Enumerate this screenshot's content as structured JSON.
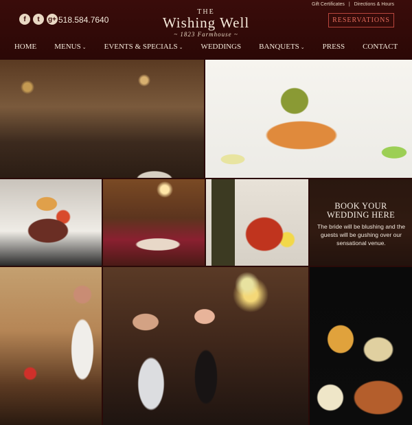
{
  "header": {
    "phone": "518.584.7640",
    "social": [
      {
        "icon": "facebook-icon",
        "glyph": "f"
      },
      {
        "icon": "twitter-icon",
        "glyph": "t"
      },
      {
        "icon": "google-plus-icon",
        "glyph": "g+"
      }
    ],
    "logo": {
      "the": "The",
      "name": "Wishing Well",
      "subtitle": "~ 1823 Farmhouse ~"
    },
    "top_links": {
      "gift": "Gift Certificates",
      "separator": "|",
      "directions": "Directions & Hours"
    },
    "reserve_label": "RESERVATIONS"
  },
  "nav": {
    "items": [
      {
        "label": "HOME",
        "caret": ""
      },
      {
        "label": "MENUS",
        "caret": "⌄"
      },
      {
        "label": "EVENTS & SPECIALS",
        "caret": "⌄"
      },
      {
        "label": "WEDDINGS",
        "caret": ""
      },
      {
        "label": "BANQUETS",
        "caret": "⌄"
      },
      {
        "label": "PRESS",
        "caret": ""
      },
      {
        "label": "CONTACT",
        "caret": ""
      }
    ]
  },
  "promo": {
    "heading_line1": "BOOK YOUR",
    "heading_line2": "WEDDING HERE",
    "text": "The bride will be blushing and the guests will be gushing over our sensational venue."
  }
}
